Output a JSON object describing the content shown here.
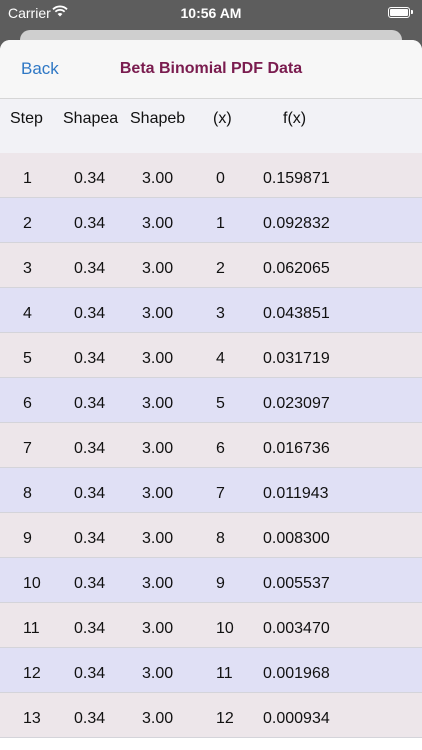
{
  "status": {
    "carrier": "Carrier",
    "time": "10:56 AM"
  },
  "nav": {
    "back_label": "Back",
    "title": "Beta Binomial PDF Data"
  },
  "table": {
    "headers": [
      "Step",
      "Shapea",
      "Shapeb",
      "(x)",
      "f(x)"
    ],
    "rows": [
      [
        "1",
        "0.34",
        "3.00",
        "0",
        "0.159871"
      ],
      [
        "2",
        "0.34",
        "3.00",
        "1",
        "0.092832"
      ],
      [
        "3",
        "0.34",
        "3.00",
        "2",
        "0.062065"
      ],
      [
        "4",
        "0.34",
        "3.00",
        "3",
        "0.043851"
      ],
      [
        "5",
        "0.34",
        "3.00",
        "4",
        "0.031719"
      ],
      [
        "6",
        "0.34",
        "3.00",
        "5",
        "0.023097"
      ],
      [
        "7",
        "0.34",
        "3.00",
        "6",
        "0.016736"
      ],
      [
        "8",
        "0.34",
        "3.00",
        "7",
        "0.011943"
      ],
      [
        "9",
        "0.34",
        "3.00",
        "8",
        "0.008300"
      ],
      [
        "10",
        "0.34",
        "3.00",
        "9",
        "0.005537"
      ],
      [
        "11",
        "0.34",
        "3.00",
        "10",
        "0.003470"
      ],
      [
        "12",
        "0.34",
        "3.00",
        "11",
        "0.001968"
      ],
      [
        "13",
        "0.34",
        "3.00",
        "12",
        "0.000934"
      ]
    ]
  },
  "colors": {
    "nav_title": "#7a1c4f",
    "back_link": "#2f78c5",
    "row_odd": "#ede6ea",
    "row_even": "#e0e0f5"
  },
  "icons": {
    "wifi": "wifi-icon",
    "battery": "battery-icon"
  }
}
